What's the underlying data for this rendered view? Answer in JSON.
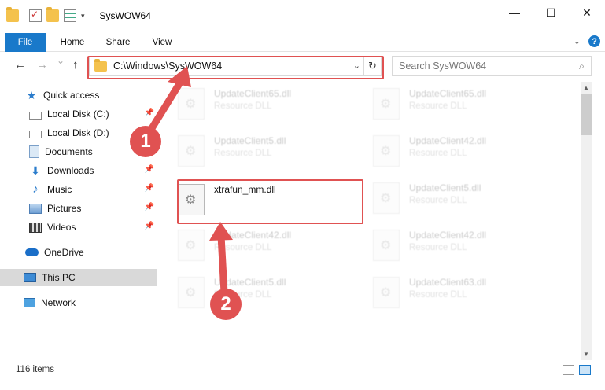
{
  "window": {
    "title": "SysWOW64"
  },
  "window_controls": {
    "minimize": "—",
    "maximize": "☐",
    "close": "✕"
  },
  "ribbon": {
    "tabs": [
      "File",
      "Home",
      "Share",
      "View"
    ],
    "expand_icon": "chevron-down-icon",
    "help_label": "?"
  },
  "nav_buttons": {
    "back": "←",
    "forward": "→",
    "recent": "⌄",
    "up": "↑"
  },
  "address": {
    "path": "C:\\Windows\\SysWOW64",
    "refresh_glyph": "↻",
    "dropdown_glyph": "⌄"
  },
  "search": {
    "placeholder": "Search SysWOW64",
    "icon_glyph": "⌕"
  },
  "navigation": [
    {
      "label": "Quick access",
      "icon": "star-icon",
      "pinned": false
    },
    {
      "label": "Local Disk (C:)",
      "icon": "disk-icon",
      "pinned": true
    },
    {
      "label": "Local Disk (D:)",
      "icon": "disk-icon",
      "pinned": false
    },
    {
      "label": "Documents",
      "icon": "documents-icon",
      "pinned": false
    },
    {
      "label": "Downloads",
      "icon": "download-icon",
      "pinned": true
    },
    {
      "label": "Music",
      "icon": "music-icon",
      "pinned": true
    },
    {
      "label": "Pictures",
      "icon": "pictures-icon",
      "pinned": true
    },
    {
      "label": "Videos",
      "icon": "video-icon",
      "pinned": true
    },
    {
      "label": "OneDrive",
      "icon": "cloud-icon",
      "pinned": false
    },
    {
      "label": "This PC",
      "icon": "pc-icon",
      "pinned": false,
      "selected": true
    },
    {
      "label": "Network",
      "icon": "network-icon",
      "pinned": false
    }
  ],
  "files": [
    {
      "name": "UpdateClient65.dll",
      "type": "Resource DLL",
      "faded": true
    },
    {
      "name": "UpdateClient65.dll",
      "type": "Resource DLL",
      "faded": true
    },
    {
      "name": "UpdateClient5.dll",
      "type": "Resource DLL",
      "faded": true
    },
    {
      "name": "UpdateClient42.dll",
      "type": "Resource DLL",
      "faded": true
    },
    {
      "name": "xtrafun_mm.dll",
      "type": "",
      "faded": false,
      "highlighted": true
    },
    {
      "name": "UpdateClient5.dll",
      "type": "Resource DLL",
      "faded": true
    },
    {
      "name": "UpdateClient42.dll",
      "type": "Resource DLL",
      "faded": true
    },
    {
      "name": "UpdateClient42.dll",
      "type": "Resource DLL",
      "faded": true
    },
    {
      "name": "UpdateClient5.dll",
      "type": "Resource DLL",
      "faded": true
    },
    {
      "name": "UpdateClient63.dll",
      "type": "Resource DLL",
      "faded": true
    }
  ],
  "status": {
    "item_count": "116 items"
  },
  "annotations": {
    "step1": "1",
    "step2": "2",
    "color": "#e05252"
  },
  "colors": {
    "accent": "#1979ca",
    "highlight": "#e05252"
  }
}
